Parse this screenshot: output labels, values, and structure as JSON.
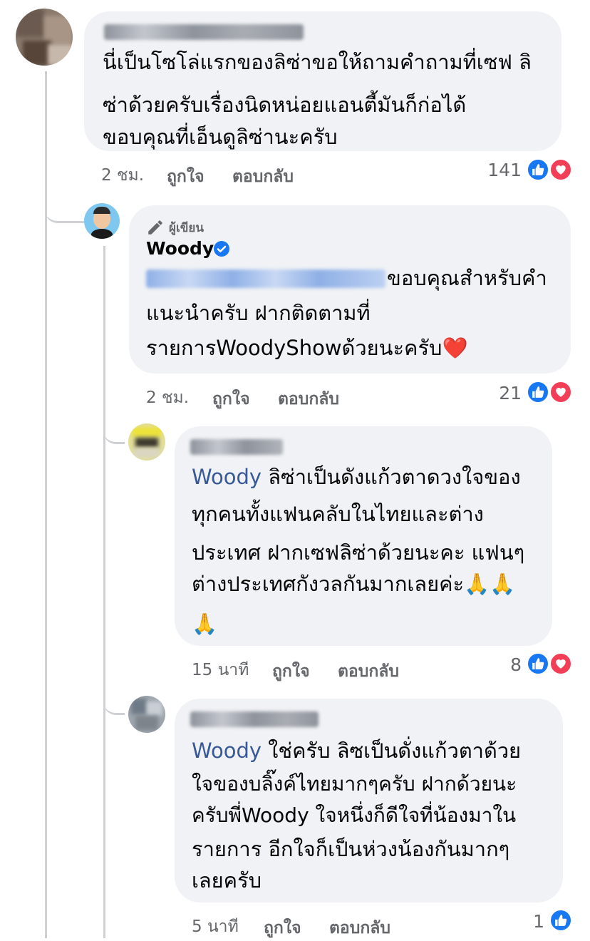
{
  "comments": [
    {
      "text": "นี่เป็นโซโล่แรกของลิซ่าขอให้ถามคำถามที่เซฟ ลิซ่าด้วยครับเรื่องนิดหน่อยแอนตี้มันก็ก่อได้ ขอบคุณที่เอ็นดูลิซ่านะครับ",
      "lines": [
        "นี่เป็นโซโล่แรกของลิซ่าขอให้ถามคำถามที่เซฟ ลิ",
        "ซ่าด้วยครับเรื่องนิดหน่อยแอนตี้มันก็ก่อได้",
        "ขอบคุณที่เอ็นดูลิซ่านะครับ"
      ],
      "time": "2 ชม.",
      "like_label": "ถูกใจ",
      "reply_label": "ตอบกลับ",
      "reaction_count": "141"
    },
    {
      "author_badge": "ผู้เขียน",
      "author": "Woody",
      "lines": [
        "ขอบคุณสำหรับคำ",
        "แนะนำครับ  ฝากติดตามที่",
        "รายการWoodyShowด้วยนะครับ❤️"
      ],
      "time": "2 ชม.",
      "like_label": "ถูกใจ",
      "reply_label": "ตอบกลับ",
      "reaction_count": "21"
    },
    {
      "mention": "Woody",
      "lines": [
        "ลิซ่าเป็นดังแก้วตาดวงใจของ",
        "ทุกคนทั้งแฟนคลับในไทยและต่าง",
        "ประเทศ ฝากเซฟลิซ่าด้วยนะคะ แฟนๆ",
        "ต่างประเทศกังวลกันมากเลยค่ะ🙏🙏",
        "🙏"
      ],
      "time": "15 นาที",
      "like_label": "ถูกใจ",
      "reply_label": "ตอบกลับ",
      "reaction_count": "8"
    },
    {
      "mention": "Woody",
      "lines": [
        "ใช่ครับ ลิซเป็นดั่งแก้วตาด้วย",
        "ใจของบลิ๊งค์ไทยมากๆครับ ฝากด้วยนะ",
        "ครับพี่Woody ใจหนึ่งก็ดีใจที่น้องมาใน",
        "รายการ อีกใจก็เป็นห่วงน้องกันมากๆ",
        "เลยครับ"
      ],
      "time": "5 นาที",
      "like_label": "ถูกใจ",
      "reply_label": "ตอบกลับ",
      "reaction_count": "1"
    }
  ],
  "icons": {
    "like": "like-icon",
    "love": "love-icon",
    "verified": "verified-badge-icon",
    "pen": "pen-icon"
  },
  "colors": {
    "bubble": "#f0f2f5",
    "meta": "#65676b",
    "mention": "#385898",
    "like": "#1877f2",
    "love": "#f33e58"
  }
}
